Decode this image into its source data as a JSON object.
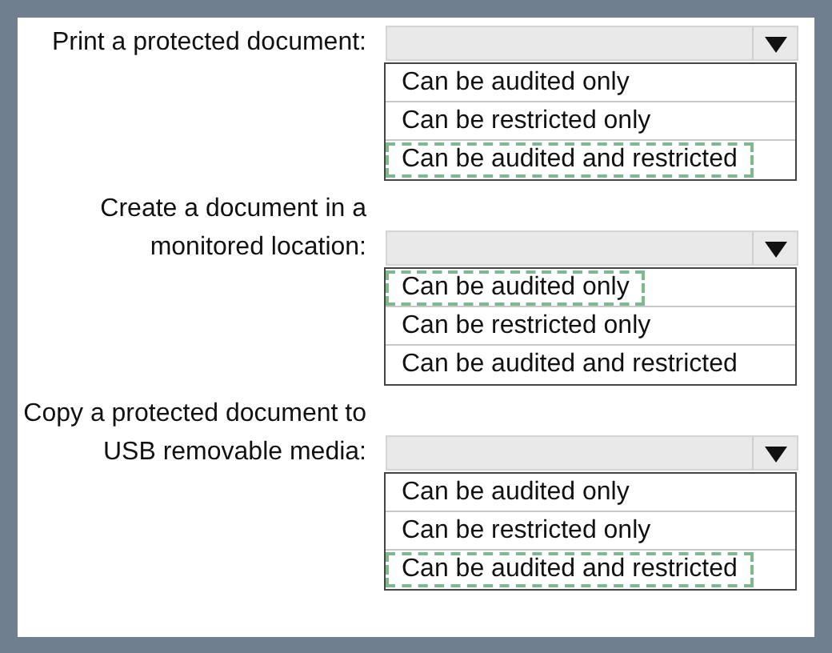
{
  "questions": [
    {
      "label": "Print a protected document:",
      "options": [
        {
          "text": "Can be audited only",
          "selected": false
        },
        {
          "text": "Can be restricted only",
          "selected": false
        },
        {
          "text": "Can be audited and restricted",
          "selected": true
        }
      ]
    },
    {
      "label": "Create a document in a monitored location:",
      "options": [
        {
          "text": "Can be audited only",
          "selected": true
        },
        {
          "text": "Can be restricted only",
          "selected": false
        },
        {
          "text": "Can be audited and restricted",
          "selected": false
        }
      ]
    },
    {
      "label": "Copy a protected document to USB removable media:",
      "options": [
        {
          "text": "Can be audited only",
          "selected": false
        },
        {
          "text": "Can be restricted only",
          "selected": false
        },
        {
          "text": "Can be audited and restricted",
          "selected": true
        }
      ]
    }
  ]
}
